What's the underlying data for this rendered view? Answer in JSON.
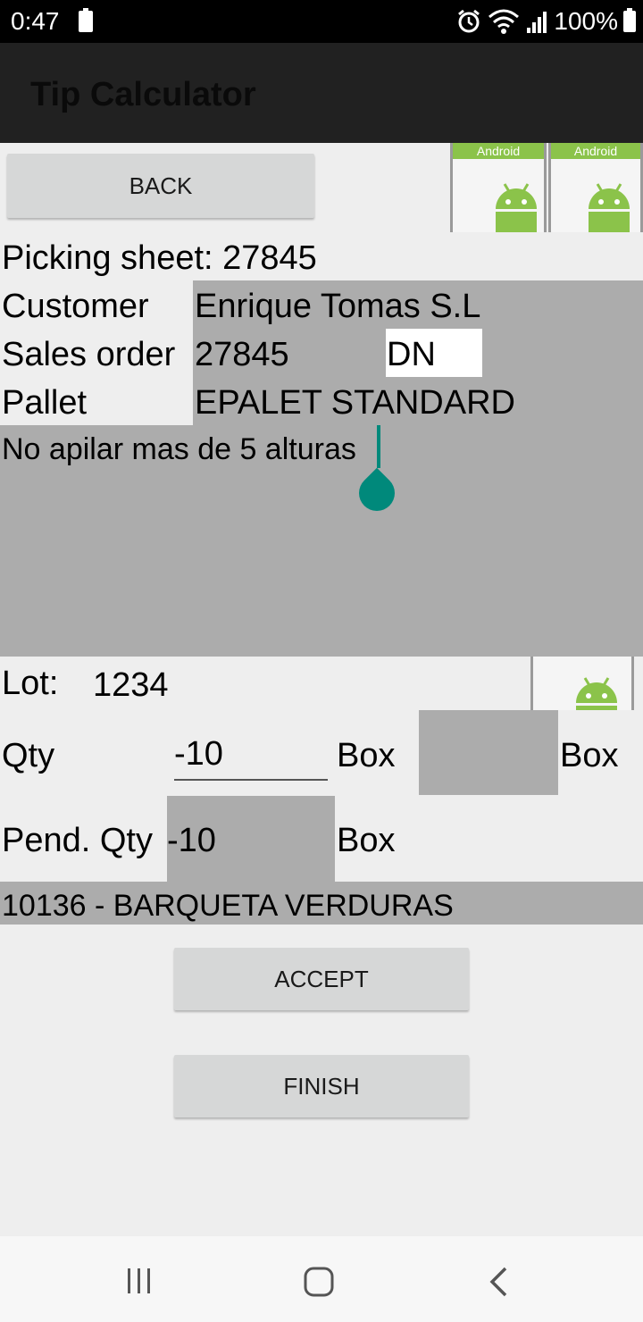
{
  "status_bar": {
    "time": "0:47",
    "battery_pct": "100%"
  },
  "app": {
    "title": "Tip Calculator"
  },
  "buttons": {
    "back": "BACK",
    "accept": "ACCEPT",
    "finish": "FINISH"
  },
  "images": {
    "banner": "Android"
  },
  "picking": {
    "sheet_label": "Picking sheet: 27845",
    "customer_label": "Customer",
    "customer_value": "Enrique Tomas S.L",
    "sales_order_label": "Sales order",
    "sales_order_value": "27845",
    "dn_value": "DN",
    "pallet_label": "Pallet",
    "pallet_value": "EPALET STANDARD",
    "notes": "No apilar mas de 5 alturas"
  },
  "lot": {
    "label": "Lot:",
    "value": "1234"
  },
  "qty": {
    "label": "Qty",
    "value": "-10",
    "unit1": "Box",
    "unit2": "Box"
  },
  "pend_qty": {
    "label": "Pend. Qty",
    "value": "-10",
    "unit": "Box"
  },
  "product": {
    "text": "10136 - BARQUETA VERDURAS"
  },
  "icons": [
    "battery-icon",
    "alarm-icon",
    "wifi-icon",
    "signal-icon",
    "android-icon",
    "recents-icon",
    "home-icon",
    "back-icon"
  ]
}
